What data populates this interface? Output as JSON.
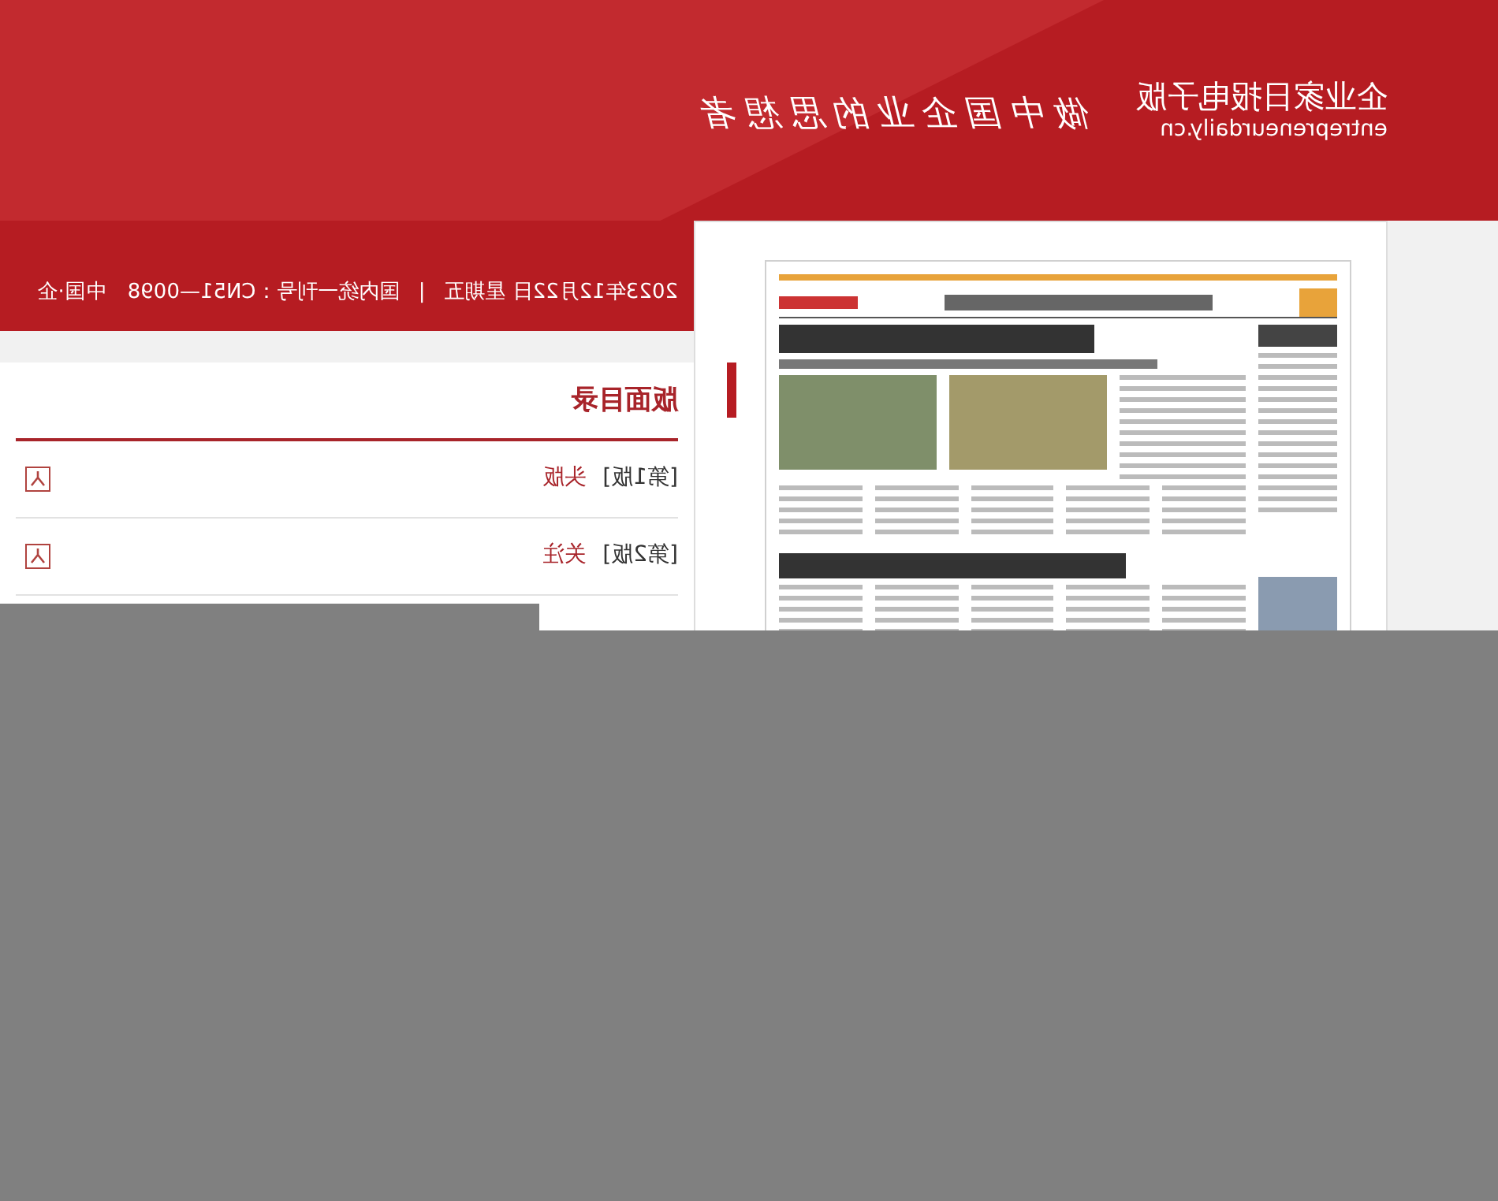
{
  "header": {
    "site_name": "企业家日报电子版",
    "domain": "entrepreneurdaily.cn",
    "slogan": "做中国企业的思想者"
  },
  "info_bar": {
    "date": "2023年12月22日 星期五",
    "separator": "|",
    "issue_number": "国内统一刊号：CN51—0098",
    "publisher": "中国·企"
  },
  "contents": {
    "title": "版面目录",
    "items": [
      {
        "edition": "[第1版]",
        "title": "头版"
      },
      {
        "edition": "[第2版]",
        "title": "关注"
      }
    ]
  }
}
